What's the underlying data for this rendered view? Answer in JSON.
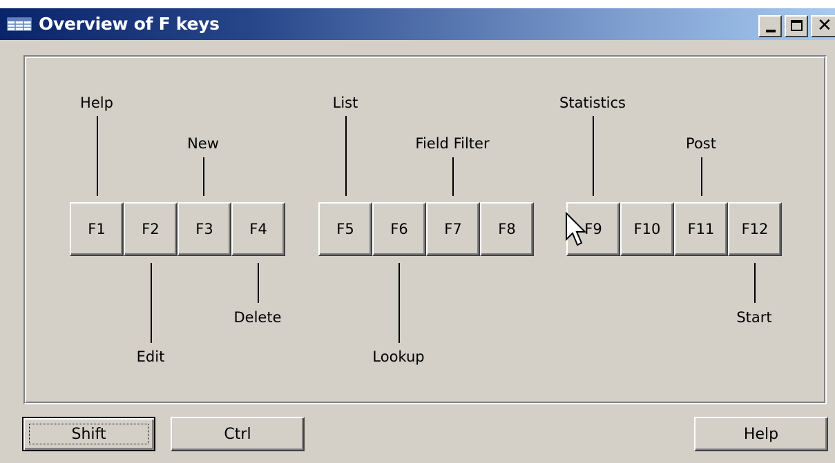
{
  "window": {
    "title": "Overview of F keys",
    "icon": "table-form-icon",
    "controls": {
      "minimize": "minimize-icon",
      "maximize": "maximize-icon",
      "close": "close-icon"
    }
  },
  "keys": [
    {
      "key": "F1",
      "label": "Help",
      "label_position": "above"
    },
    {
      "key": "F2",
      "label": "Edit",
      "label_position": "below"
    },
    {
      "key": "F3",
      "label": "New",
      "label_position": "above"
    },
    {
      "key": "F4",
      "label": "Delete",
      "label_position": "below"
    },
    {
      "key": "F5",
      "label": "List",
      "label_position": "above"
    },
    {
      "key": "F6",
      "label": "Lookup",
      "label_position": "below"
    },
    {
      "key": "F7",
      "label": "Field Filter",
      "label_position": "above"
    },
    {
      "key": "F8",
      "label": "",
      "label_position": "none"
    },
    {
      "key": "F9",
      "label": "Statistics",
      "label_position": "above"
    },
    {
      "key": "F10",
      "label": "",
      "label_position": "none"
    },
    {
      "key": "F11",
      "label": "Post",
      "label_position": "above"
    },
    {
      "key": "F12",
      "label": "Start",
      "label_position": "below"
    }
  ],
  "buttons": {
    "shift": "Shift",
    "ctrl": "Ctrl",
    "help": "Help"
  },
  "cursor": "mouse-pointer-icon",
  "colors": {
    "face": "#d4d0c8",
    "title_start": "#0a246a",
    "title_end": "#a6caf0",
    "title_text": "#ffffff"
  }
}
